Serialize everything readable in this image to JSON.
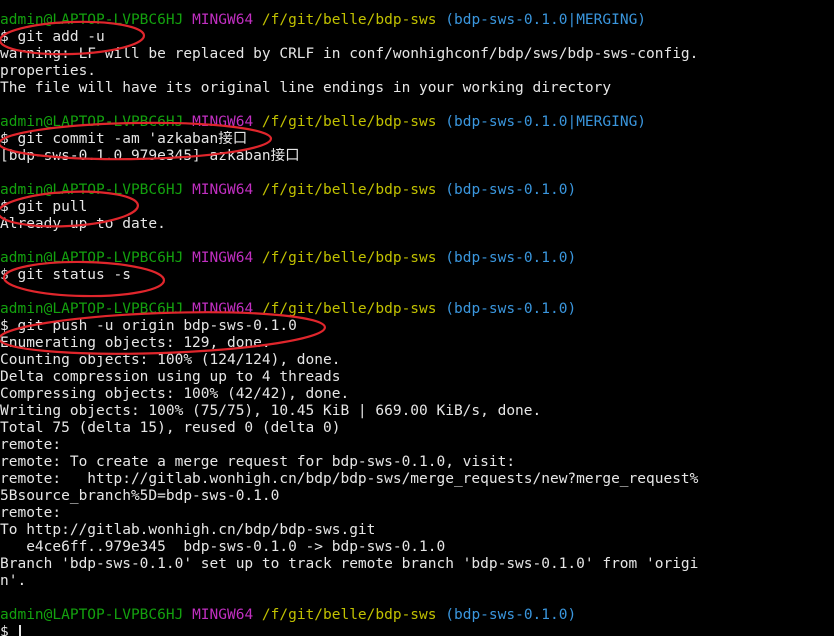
{
  "prompt": {
    "user_host": "admin@LAPTOP-LVPBC6HJ",
    "env": "MINGW64",
    "path": "/f/git/belle/bdp-sws",
    "branch_merging": "(bdp-sws-0.1.0|MERGING)",
    "branch": "(bdp-sws-0.1.0)"
  },
  "lines": [
    {
      "t": "prompt-merging"
    },
    {
      "t": "cmd",
      "text": "$ git add -u"
    },
    {
      "t": "out",
      "text": "warning: LF will be replaced by CRLF in conf/wonhighconf/bdp/sws/bdp-sws-config."
    },
    {
      "t": "out",
      "text": "properties."
    },
    {
      "t": "out",
      "text": "The file will have its original line endings in your working directory"
    },
    {
      "t": "blank"
    },
    {
      "t": "prompt-merging"
    },
    {
      "t": "cmd",
      "text": "$ git commit -am 'azkaban接口"
    },
    {
      "t": "out",
      "text": "[bdp-sws-0.1.0 979e345] azkaban接口"
    },
    {
      "t": "blank"
    },
    {
      "t": "prompt"
    },
    {
      "t": "cmd",
      "text": "$ git pull"
    },
    {
      "t": "out",
      "text": "Already up to date."
    },
    {
      "t": "blank"
    },
    {
      "t": "prompt"
    },
    {
      "t": "cmd",
      "text": "$ git status -s"
    },
    {
      "t": "blank"
    },
    {
      "t": "prompt"
    },
    {
      "t": "cmd",
      "text": "$ git push -u origin bdp-sws-0.1.0"
    },
    {
      "t": "out",
      "text": "Enumerating objects: 129, done."
    },
    {
      "t": "out",
      "text": "Counting objects: 100% (124/124), done."
    },
    {
      "t": "out",
      "text": "Delta compression using up to 4 threads"
    },
    {
      "t": "out",
      "text": "Compressing objects: 100% (42/42), done."
    },
    {
      "t": "out",
      "text": "Writing objects: 100% (75/75), 10.45 KiB | 669.00 KiB/s, done."
    },
    {
      "t": "out",
      "text": "Total 75 (delta 15), reused 0 (delta 0)"
    },
    {
      "t": "out",
      "text": "remote:"
    },
    {
      "t": "out",
      "text": "remote: To create a merge request for bdp-sws-0.1.0, visit:"
    },
    {
      "t": "out",
      "text": "remote:   http://gitlab.wonhigh.cn/bdp/bdp-sws/merge_requests/new?merge_request%"
    },
    {
      "t": "out",
      "text": "5Bsource_branch%5D=bdp-sws-0.1.0"
    },
    {
      "t": "out",
      "text": "remote:"
    },
    {
      "t": "out",
      "text": "To http://gitlab.wonhigh.cn/bdp/bdp-sws.git"
    },
    {
      "t": "out",
      "text": "   e4ce6ff..979e345  bdp-sws-0.1.0 -> bdp-sws-0.1.0"
    },
    {
      "t": "out",
      "text": "Branch 'bdp-sws-0.1.0' set up to track remote branch 'bdp-sws-0.1.0' from 'origi"
    },
    {
      "t": "out",
      "text": "n'."
    },
    {
      "t": "blank"
    },
    {
      "t": "prompt"
    },
    {
      "t": "cmd-cursor",
      "text": "$ "
    }
  ]
}
